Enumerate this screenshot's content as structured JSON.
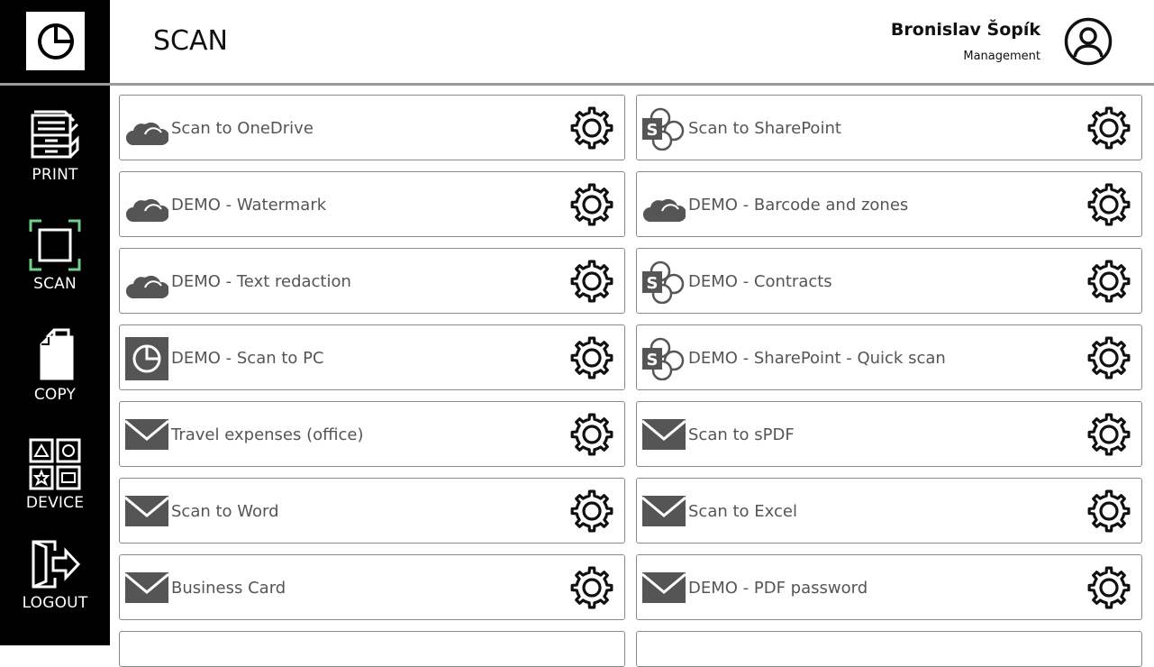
{
  "header": {
    "title": "SCAN",
    "user_name": "Bronislav Šopík",
    "user_role": "Management"
  },
  "sidebar": {
    "items": [
      {
        "label": "PRINT",
        "icon": "printer-icon"
      },
      {
        "label": "SCAN",
        "icon": "scan-icon",
        "active": true
      },
      {
        "label": "COPY",
        "icon": "copy-icon"
      },
      {
        "label": "DEVICE",
        "icon": "device-icon"
      },
      {
        "label": "LOGOUT",
        "icon": "logout-icon"
      }
    ]
  },
  "colors": {
    "sidebar_bg": "#000000",
    "scan_accent": "#6fd08c",
    "tile_text": "#555555",
    "icon_gray": "#555555"
  },
  "workflows": [
    {
      "label": "Scan to OneDrive",
      "icon": "cloud-icon"
    },
    {
      "label": "Scan to SharePoint",
      "icon": "sharepoint-icon"
    },
    {
      "label": "DEMO - Watermark",
      "icon": "cloud-icon"
    },
    {
      "label": "DEMO - Barcode and zones",
      "icon": "cloud-icon"
    },
    {
      "label": "DEMO - Text redaction",
      "icon": "cloud-icon"
    },
    {
      "label": "DEMO - Contracts",
      "icon": "sharepoint-icon"
    },
    {
      "label": "DEMO - Scan to PC",
      "icon": "pc-icon"
    },
    {
      "label": "DEMO - SharePoint  - Quick scan",
      "icon": "sharepoint-icon"
    },
    {
      "label": "Travel expenses (office)",
      "icon": "mail-icon"
    },
    {
      "label": "Scan to sPDF",
      "icon": "mail-icon"
    },
    {
      "label": "Scan to Word",
      "icon": "mail-icon"
    },
    {
      "label": "Scan to Excel",
      "icon": "mail-icon"
    },
    {
      "label": "Business Card",
      "icon": "mail-icon"
    },
    {
      "label": "DEMO - PDF password",
      "icon": "mail-icon"
    }
  ]
}
